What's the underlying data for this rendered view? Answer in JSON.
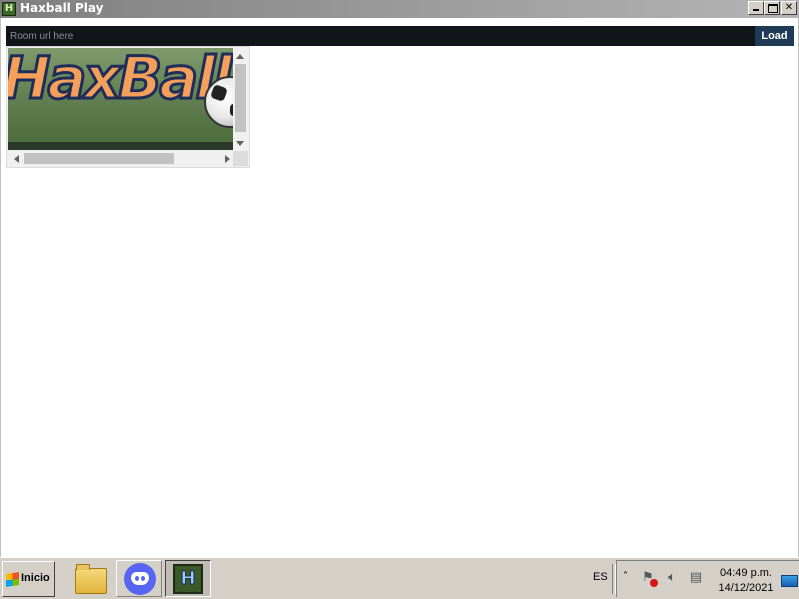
{
  "window": {
    "title": "Haxball Play",
    "icon": "H"
  },
  "urlbar": {
    "placeholder": "Room url here",
    "value": "",
    "load_label": "Load"
  },
  "banner": {
    "logo_text": "HaxBall"
  },
  "taskbar": {
    "start_label": "Inicio",
    "apps": [
      "file-explorer",
      "discord",
      "haxball"
    ],
    "haxball_icon": "H",
    "language": "ES",
    "time": "04:49 p.m.",
    "date": "14/12/2021"
  }
}
